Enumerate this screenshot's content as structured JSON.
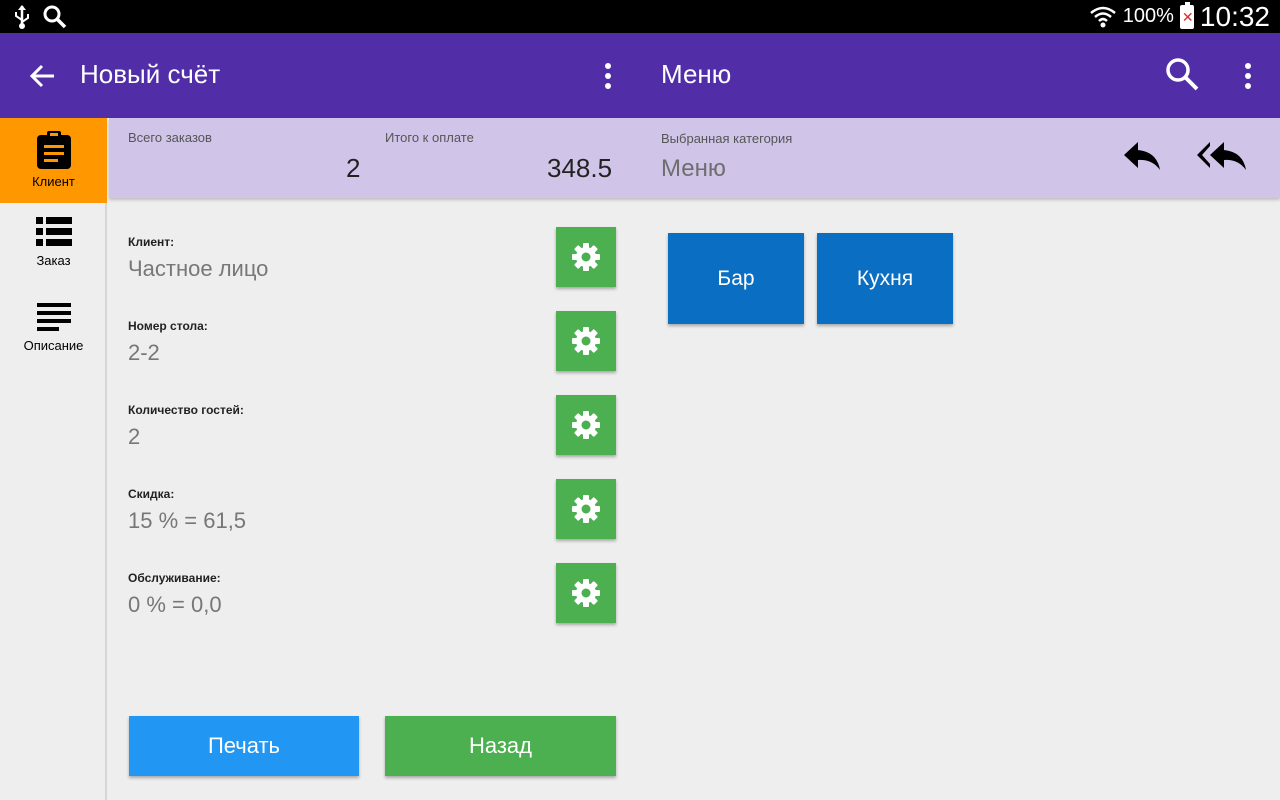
{
  "status_bar": {
    "battery_percent": "100%",
    "time": "10:32",
    "icons": [
      "usb-icon",
      "search-icon",
      "wifi-icon",
      "battery-icon"
    ]
  },
  "app_bar": {
    "left_title": "Новый счёт",
    "right_title": "Меню",
    "color": "#512da8"
  },
  "sidebar": {
    "items": [
      {
        "label": "Клиент",
        "icon": "clipboard-icon",
        "active": true
      },
      {
        "label": "Заказ",
        "icon": "list-icon",
        "active": false
      },
      {
        "label": "Описание",
        "icon": "text-lines-icon",
        "active": false
      }
    ],
    "active_color": "#ff9800"
  },
  "summary": {
    "orders_label": "Всего заказов",
    "orders_value": "2",
    "total_label": "Итого к оплате",
    "total_value": "348.5",
    "category_label": "Выбранная категория",
    "category_value": "Меню"
  },
  "fields": [
    {
      "label": "Клиент:",
      "value": "Частное лицо"
    },
    {
      "label": "Номер стола:",
      "value": "2-2"
    },
    {
      "label": "Количество гостей:",
      "value": "2"
    },
    {
      "label": "Скидка:",
      "value": "15 % = 61,5"
    },
    {
      "label": "Обслуживание:",
      "value": "0 % = 0,0"
    }
  ],
  "actions": {
    "print_label": "Печать",
    "back_label": "Назад"
  },
  "categories": [
    {
      "label": "Бар"
    },
    {
      "label": "Кухня"
    }
  ],
  "colors": {
    "gear_button": "#4caf50",
    "print_button": "#2196f3",
    "category_button": "#0a6fc2",
    "summary_bg": "#d1c4e9"
  }
}
